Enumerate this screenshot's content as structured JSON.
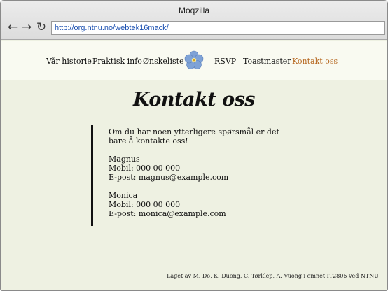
{
  "window": {
    "title": "Moqzilla"
  },
  "toolbar": {
    "back_icon": "arrow-left-icon",
    "forward_icon": "arrow-right-icon",
    "reload_icon": "reload-icon",
    "url": "http://org.ntnu.no/webtek16mack/"
  },
  "menu": {
    "items": [
      {
        "label": "Vår historie"
      },
      {
        "label": "Praktisk info"
      },
      {
        "label": "Ønskeliste"
      },
      {
        "label": "RSVP"
      },
      {
        "label": "Toastmaster"
      },
      {
        "label": "Kontakt oss",
        "active": true
      }
    ],
    "logo_icon": "forget-me-not-flower-icon",
    "active_color": "#b5651d"
  },
  "page": {
    "title": "Kontakt oss",
    "intro": "Om du har noen ytterligere spørsmål er det bare å kontakte oss!",
    "contacts": [
      {
        "name": "Magnus",
        "phone": "Mobil: 000 00 000",
        "email": "E-post: magnus@example.com"
      },
      {
        "name": "Monica",
        "phone": "Mobil: 000 00 000",
        "email": "E-post: monica@example.com"
      }
    ]
  },
  "footer": {
    "text": "Laget av M. Do, K. Duong, C. Tørklep, A. Vuong i emnet IT2805 ved NTNU"
  },
  "colors": {
    "page_background": "#eef1e2",
    "header_background": "#f9faf1",
    "link": "#1a4fb0"
  }
}
